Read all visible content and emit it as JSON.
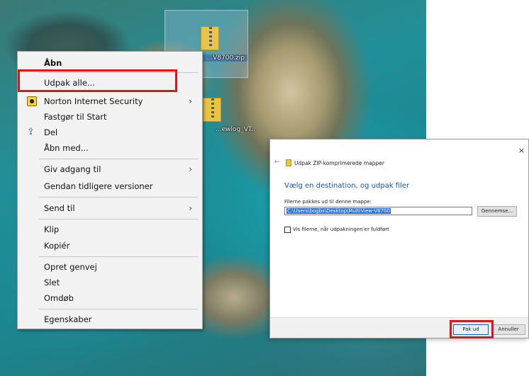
{
  "desktop": {
    "icons": [
      {
        "label": "...V8700.zip"
      },
      {
        "label": "...ewlog_VT..."
      }
    ]
  },
  "context_menu": {
    "items": [
      {
        "label": "Åbn"
      },
      {
        "label": "Udpak alle..."
      },
      {
        "label": "Norton Internet Security"
      },
      {
        "label": "Fastgør til Start"
      },
      {
        "label": "Del"
      },
      {
        "label": "Åbn med..."
      },
      {
        "label": "Giv adgang til"
      },
      {
        "label": "Gendan tidligere versioner"
      },
      {
        "label": "Send til"
      },
      {
        "label": "Klip"
      },
      {
        "label": "Kopiér"
      },
      {
        "label": "Opret genvej"
      },
      {
        "label": "Slet"
      },
      {
        "label": "Omdøb"
      },
      {
        "label": "Egenskaber"
      }
    ],
    "submenu_arrow": "›"
  },
  "dialog": {
    "close_glyph": "×",
    "back_glyph": "←",
    "title": "Udpak ZIP-komprimerede mapper",
    "heading": "Vælg en destination, og udpak filer",
    "field_label": "Filerne pakkes ud til denne mappe:",
    "path_value": "C:\\Users\\bogbs\\Desktop\\MultiView-V8700",
    "browse_label": "Gennemse...",
    "checkbox_label": "Vis filerne, når udpakningen er fuldført",
    "checkbox_checked": false,
    "ok_label": "Pak ud",
    "cancel_label": "Annuller"
  },
  "colors": {
    "highlight_box": "#e0141e",
    "heading_blue": "#1a4fa8",
    "selection_blue": "#2f6fd6"
  }
}
